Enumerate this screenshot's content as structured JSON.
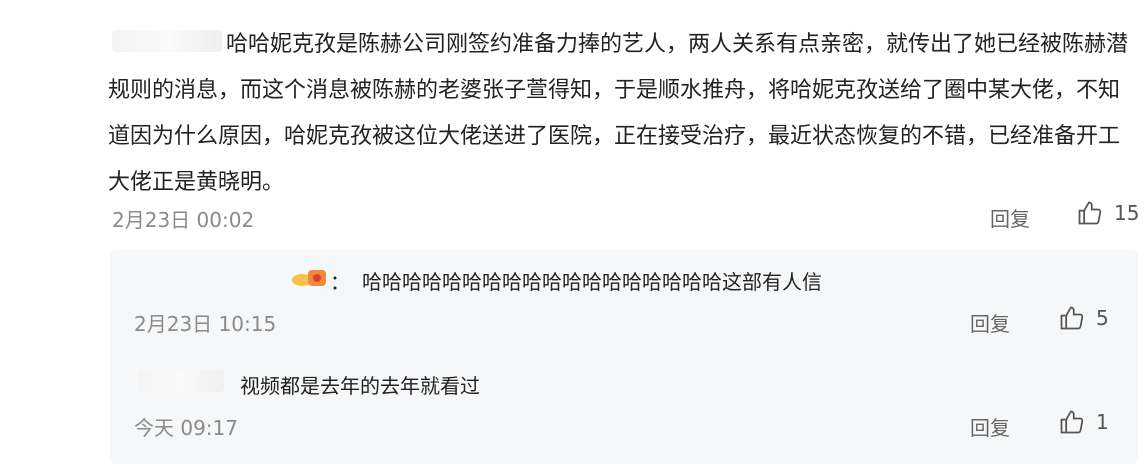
{
  "main_comment": {
    "text": "哈哈妮克孜是陈赫公司刚签约准备力捧的艺人，两人关系有点亲密，就传出了她已经被陈赫潜规则的消息，而这个消息被陈赫的老婆张子萱得知，于是顺水推舟，将哈妮克孜送给了圈中某大佬，不知道因为什么原因，哈妮克孜被这位大佬送进了医院，正在接受治疗，最近状态恢复的不错，已经准备开工大佬正是黄晓明。",
    "timestamp": "2月23日 00:02",
    "reply_label": "回复",
    "like_count": "15"
  },
  "replies": [
    {
      "separator": "：",
      "text": "哈哈哈哈哈哈哈哈哈哈哈哈哈哈哈哈哈哈这部有人信",
      "timestamp": "2月23日 10:15",
      "reply_label": "回复",
      "like_count": "5"
    },
    {
      "text": "视频都是去年的去年就看过",
      "timestamp": "今天 09:17",
      "reply_label": "回复",
      "like_count": "1"
    }
  ],
  "icons": {
    "like": "thumbs-up-icon",
    "user_badge": "user-badge-icon"
  }
}
